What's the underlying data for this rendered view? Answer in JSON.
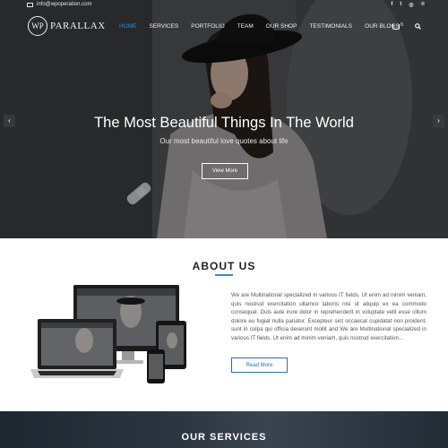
{
  "colors": {
    "accent": "#2b8fd6",
    "button_blue": "#2b6fb0"
  },
  "topbar": {
    "email": "info@wpoperation.com",
    "social_icons": [
      "facebook-icon",
      "twitter-icon",
      "instagram-icon",
      "pinterest-icon"
    ],
    "social_glyphs": [
      "f",
      "t",
      "◎",
      "℗"
    ]
  },
  "logo": {
    "mark": "WP",
    "text": "PARALLAX"
  },
  "nav": {
    "items": [
      "HOME",
      "SERVICES",
      "PORTFOLIO",
      "TEAM",
      "OUR SHOP",
      "TESTIMONIALS",
      "OUR BLOGS"
    ],
    "active": "HOME",
    "cart_count": "0"
  },
  "hero": {
    "title": "The Most Beautiful Things In The World",
    "subtitle": "Our most beautiful love quotes about life",
    "button": "View More",
    "prev_glyph": "‹",
    "next_glyph": "›"
  },
  "about": {
    "title": "ABOUT US",
    "body": "We are Multinational specialized in various IT fields. Ut enim ad minim veniam, quis nostrud exercitation ullamco laboris nisi ut aliquip ex ea commodo consequat. Duis aute irure dolor in reprehenderit in voluptate velit esse cillum dolore eu fugiat nulla pariatur. Excepteur sint occaecat cupidatat non proident, sunt in culpa qui officia deserunt mollit and We are Multinational specialized in various IT fields. Ut enim ad minim veniam, quis nostrud exercitation...",
    "button": "Read More"
  },
  "services": {
    "title": "OUR SERVICES"
  }
}
